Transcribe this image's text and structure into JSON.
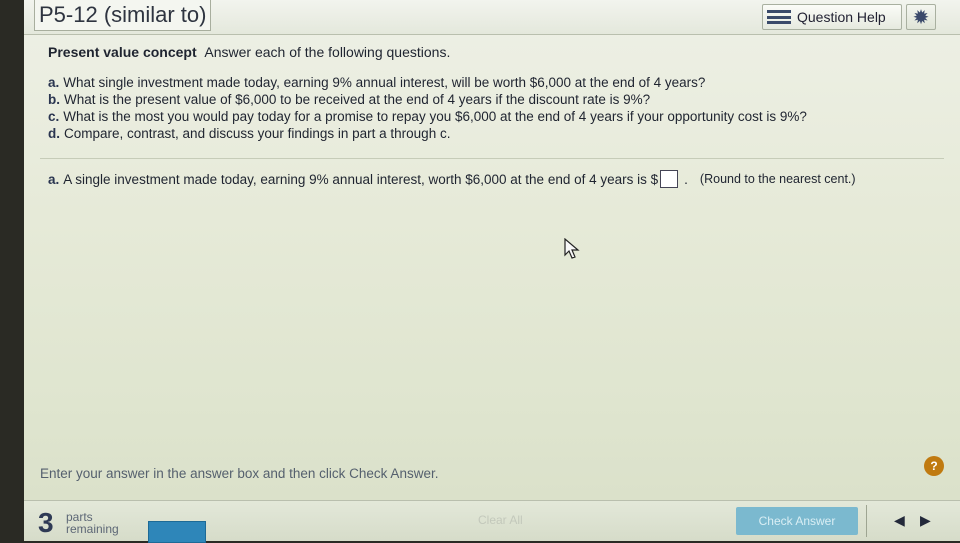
{
  "header": {
    "title": "P5-12 (similar to)",
    "help_label": "Question Help",
    "settings_icon": "gear-icon"
  },
  "question": {
    "topic": "Present value concept",
    "prompt": "Answer each of the following questions.",
    "items": [
      {
        "letter": "a.",
        "text": "What single investment made today, earning 9% annual interest, will be worth $6,000 at the end of 4 years?"
      },
      {
        "letter": "b.",
        "text": "What is the present value of $6,000 to be received at the end of 4 years if the discount rate is 9%?"
      },
      {
        "letter": "c.",
        "text": "What is the most you would pay today for a promise to repay you $6,000 at the end of 4 years if your opportunity cost is 9%?"
      },
      {
        "letter": "d.",
        "text": "Compare, contrast, and discuss your findings in part a through c."
      }
    ]
  },
  "answer": {
    "letter": "a.",
    "text": "A single investment made today, earning 9% annual interest, worth $6,000 at the end of 4 years is",
    "currency": "$",
    "value": "",
    "suffix": ".",
    "note": "(Round to the nearest cent.)"
  },
  "footer": {
    "instruction": "Enter your answer in the answer box and then click Check Answer.",
    "help_symbol": "?",
    "parts_count": "3",
    "parts_label_1": "parts",
    "parts_label_2": "remaining",
    "clear_label": "Clear All",
    "check_label": "Check Answer",
    "prev_symbol": "◀",
    "next_symbol": "▶"
  }
}
